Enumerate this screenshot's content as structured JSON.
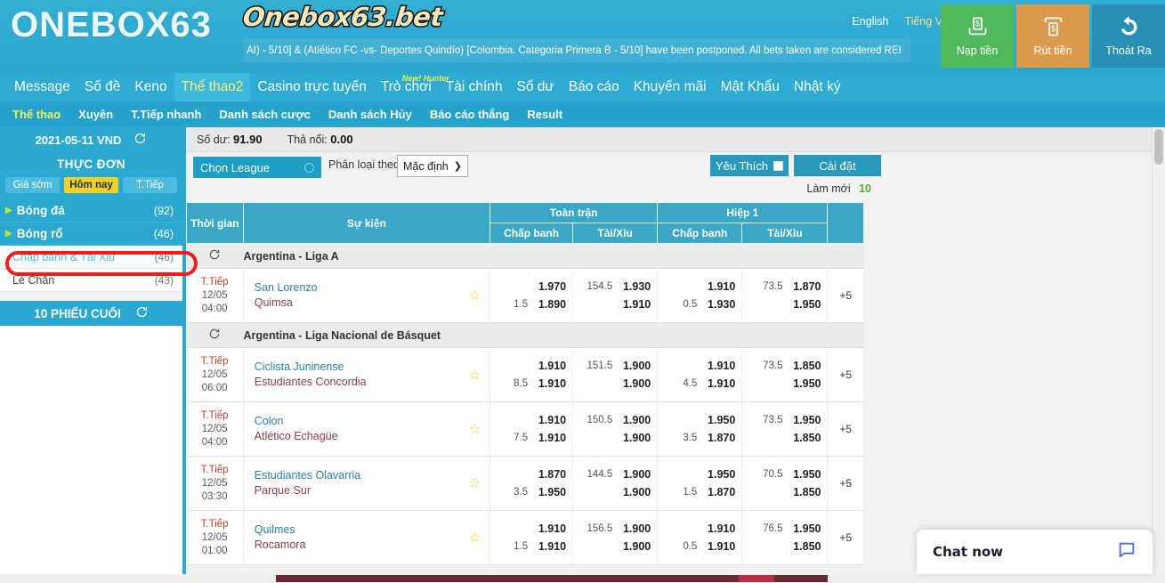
{
  "header": {
    "logo": "ONEBOX63",
    "brand_badge": "Onebox63.bet",
    "marquee": "AI) - 5/10] & (Atlético FC -vs- Deportes Quindío) [Colombia. Categoria Primera B - 5/10] have been postponed. All bets taken are considered REI",
    "lang_en": "English",
    "lang_vi": "Tiếng Việt",
    "buttons": [
      {
        "label": "Nạp tiền",
        "icon": "deposit-money-icon",
        "color": "#52b85c"
      },
      {
        "label": "Rút tiền",
        "icon": "withdraw-money-icon",
        "color": "#dc9a4e"
      },
      {
        "label": "Thoát Ra",
        "icon": "logout-arrow-icon",
        "color": "#2790b4"
      }
    ]
  },
  "nav_primary": [
    {
      "label": "Message",
      "active": false
    },
    {
      "label": "Số đề",
      "active": false
    },
    {
      "label": "Keno",
      "active": false
    },
    {
      "label": "Thể thao2",
      "active": true
    },
    {
      "label": "Casino trực tuyến",
      "active": false
    },
    {
      "label": "Trò chơi",
      "active": false,
      "badge": "New! Hunter"
    },
    {
      "label": "Tài chính",
      "active": false
    },
    {
      "label": "Số dư",
      "active": false
    },
    {
      "label": "Báo cáo",
      "active": false
    },
    {
      "label": "Khuyến mãi",
      "active": false
    },
    {
      "label": "Mật Khẩu",
      "active": false
    },
    {
      "label": "Nhật ký",
      "active": false
    }
  ],
  "nav_secondary": [
    {
      "label": "Thể thao",
      "active": true
    },
    {
      "label": "Xuyên",
      "active": false
    },
    {
      "label": "T.Tiếp nhanh",
      "active": false
    },
    {
      "label": "Danh sách cược",
      "active": false
    },
    {
      "label": "Danh sách Hủy",
      "active": false
    },
    {
      "label": "Báo cáo thắng",
      "active": false
    },
    {
      "label": "Result",
      "active": false
    }
  ],
  "sidebar": {
    "date": "2021-05-11 VND",
    "refresh_icon": "refresh-icon",
    "menu_title": "THỰC ĐƠN",
    "tabs": [
      {
        "label": "Giá sớm",
        "selected": false
      },
      {
        "label": "Hôm nay",
        "selected": true
      },
      {
        "label": "T.Tiếp",
        "selected": false
      }
    ],
    "categories": [
      {
        "label": "Bóng đá",
        "count": "(92)"
      },
      {
        "label": "Bóng rổ",
        "count": "(46)"
      }
    ],
    "subcategories": [
      {
        "label": "Chấp banh & Tài Xỉu",
        "count": "(46)",
        "selected": true
      },
      {
        "label": "Lẻ Chẵn",
        "count": "(43)",
        "selected": false
      }
    ],
    "last_tickets_title": "10 PHIẾU CUỐI"
  },
  "toolbar": {
    "balance_label": "Số dư:",
    "balance_value": "91.90",
    "float_label": "Thả nổi:",
    "float_value": "0.00",
    "choose_league": "Chọn League",
    "sort_label": "Phân loại theo",
    "sort_value": "Mặc định",
    "favorite_label": "Yêu Thích",
    "settings_label": "Cài đặt",
    "refresh_label": "Làm mới",
    "refresh_seconds": "10"
  },
  "table": {
    "headers": {
      "time": "Thời gian",
      "event": "Sự kiện",
      "full_match": "Toàn trận",
      "half_one": "Hiệp 1",
      "handicap": "Chấp banh",
      "over_under": "Tài/Xỉu"
    },
    "groups": [
      {
        "league": "Argentina - Liga A",
        "matches": [
          {
            "status": "T.Tiếp",
            "date": "12/05",
            "time": "04:00",
            "home": "San Lorenzo",
            "away": "Quimsa",
            "star_icon": "star-icon",
            "ft_ah_top_hdp": "",
            "ft_ah_top_price": "1.970",
            "ft_ah_bot_hdp": "1.5",
            "ft_ah_bot_price": "1.890",
            "ft_ou_top_hdp": "154.5",
            "ft_ou_top_price": "1.930",
            "ft_ou_bot_hdp": "",
            "ft_ou_bot_price": "1.910",
            "h1_ah_top_hdp": "",
            "h1_ah_top_price": "1.910",
            "h1_ah_bot_hdp": "0.5",
            "h1_ah_bot_price": "1.930",
            "h1_ou_top_hdp": "73.5",
            "h1_ou_top_price": "1.870",
            "h1_ou_bot_hdp": "",
            "h1_ou_bot_price": "1.950",
            "more": "+5"
          }
        ]
      },
      {
        "league": "Argentina - Liga Nacional de Básquet",
        "matches": [
          {
            "status": "T.Tiếp",
            "date": "12/05",
            "time": "06:00",
            "home": "Ciclista Juninense",
            "away": "Estudiantes Concordia",
            "star_icon": "star-icon",
            "ft_ah_top_hdp": "",
            "ft_ah_top_price": "1.910",
            "ft_ah_bot_hdp": "8.5",
            "ft_ah_bot_price": "1.910",
            "ft_ou_top_hdp": "151.5",
            "ft_ou_top_price": "1.900",
            "ft_ou_bot_hdp": "",
            "ft_ou_bot_price": "1.900",
            "h1_ah_top_hdp": "",
            "h1_ah_top_price": "1.910",
            "h1_ah_bot_hdp": "4.5",
            "h1_ah_bot_price": "1.910",
            "h1_ou_top_hdp": "73.5",
            "h1_ou_top_price": "1.850",
            "h1_ou_bot_hdp": "",
            "h1_ou_bot_price": "1.950",
            "more": "+5"
          },
          {
            "status": "T.Tiếp",
            "date": "12/05",
            "time": "04:00",
            "home": "Colon",
            "away": "Atlético Echagüe",
            "star_icon": "star-icon",
            "ft_ah_top_hdp": "",
            "ft_ah_top_price": "1.910",
            "ft_ah_bot_hdp": "7.5",
            "ft_ah_bot_price": "1.910",
            "ft_ou_top_hdp": "150.5",
            "ft_ou_top_price": "1.900",
            "ft_ou_bot_hdp": "",
            "ft_ou_bot_price": "1.900",
            "h1_ah_top_hdp": "",
            "h1_ah_top_price": "1.950",
            "h1_ah_bot_hdp": "3.5",
            "h1_ah_bot_price": "1.870",
            "h1_ou_top_hdp": "73.5",
            "h1_ou_top_price": "1.950",
            "h1_ou_bot_hdp": "",
            "h1_ou_bot_price": "1.850",
            "more": "+5"
          },
          {
            "status": "T.Tiếp",
            "date": "12/05",
            "time": "03:30",
            "home": "Estudiantes Olavarria",
            "away": "Parque Sur",
            "star_icon": "star-icon",
            "ft_ah_top_hdp": "",
            "ft_ah_top_price": "1.870",
            "ft_ah_bot_hdp": "3.5",
            "ft_ah_bot_price": "1.950",
            "ft_ou_top_hdp": "144.5",
            "ft_ou_top_price": "1.900",
            "ft_ou_bot_hdp": "",
            "ft_ou_bot_price": "1.900",
            "h1_ah_top_hdp": "",
            "h1_ah_top_price": "1.950",
            "h1_ah_bot_hdp": "1.5",
            "h1_ah_bot_price": "1.870",
            "h1_ou_top_hdp": "70.5",
            "h1_ou_top_price": "1.950",
            "h1_ou_bot_hdp": "",
            "h1_ou_bot_price": "1.850",
            "more": "+5"
          },
          {
            "status": "T.Tiếp",
            "date": "12/05",
            "time": "01:00",
            "home": "Quilmes",
            "away": "Rocamora",
            "star_icon": "star-icon",
            "ft_ah_top_hdp": "",
            "ft_ah_top_price": "1.910",
            "ft_ah_bot_hdp": "1.5",
            "ft_ah_bot_price": "1.910",
            "ft_ou_top_hdp": "156.5",
            "ft_ou_top_price": "1.900",
            "ft_ou_bot_hdp": "",
            "ft_ou_bot_price": "1.900",
            "h1_ah_top_hdp": "",
            "h1_ah_top_price": "1.910",
            "h1_ah_bot_hdp": "0.5",
            "h1_ah_bot_price": "1.910",
            "h1_ou_top_hdp": "76.5",
            "h1_ou_top_price": "1.950",
            "h1_ou_bot_hdp": "",
            "h1_ou_bot_price": "1.850",
            "more": "+5"
          }
        ]
      }
    ]
  },
  "chat": {
    "label": "Chat now",
    "icon": "chat-bubble-icon"
  }
}
